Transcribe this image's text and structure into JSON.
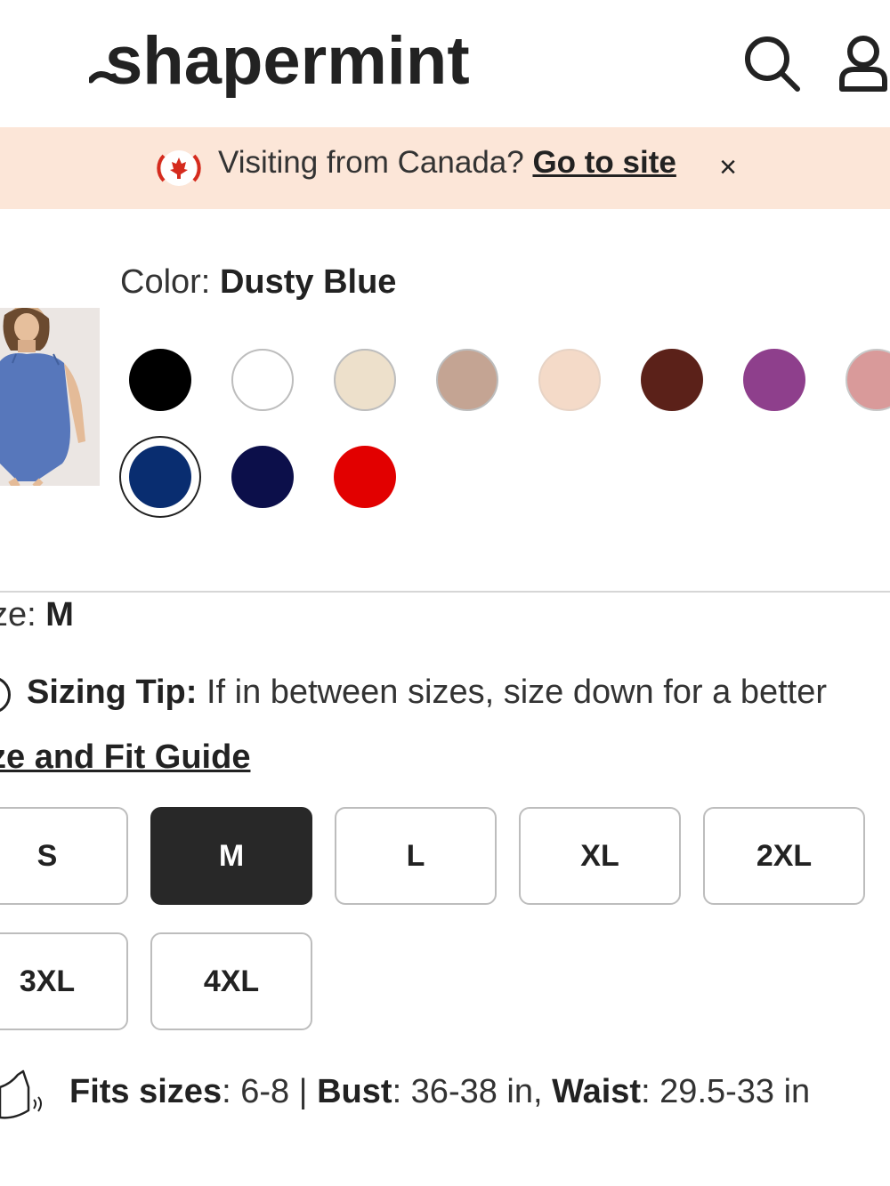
{
  "header": {
    "logo_text": "shapermint",
    "menu_icon": "menu-icon",
    "search_icon": "search-icon",
    "account_icon": "account-icon"
  },
  "banner": {
    "flag_icon": "canada-flag-icon",
    "text": "Visiting from Canada?",
    "link": "Go to site",
    "close": "×",
    "background": "#fce6d8"
  },
  "color": {
    "label": "Color:",
    "selected": "Dusty Blue",
    "swatches": [
      "#000000",
      "#ffffff",
      "#ede0cb",
      "#c4a493",
      "#f4dac8",
      "#5b2119",
      "#8e3f8c",
      "#d99a9a",
      "#092d70",
      "#0c0f4a",
      "#e20000"
    ]
  },
  "size": {
    "label": "ze:",
    "selected": "M",
    "tip_title": "Sizing Tip:",
    "tip_text": "If in between sizes, size down for a better",
    "guide_link": "ze and Fit Guide",
    "options": [
      "S",
      "M",
      "L",
      "XL",
      "2XL",
      "3XL",
      "4XL"
    ]
  },
  "fit": {
    "sizes_label": "Fits sizes",
    "sizes_value": ": 6-8 | ",
    "bust_label": "Bust",
    "bust_value": ": 36-38 in, ",
    "waist_label": "Waist",
    "waist_value": ": 29.5-33 in"
  }
}
